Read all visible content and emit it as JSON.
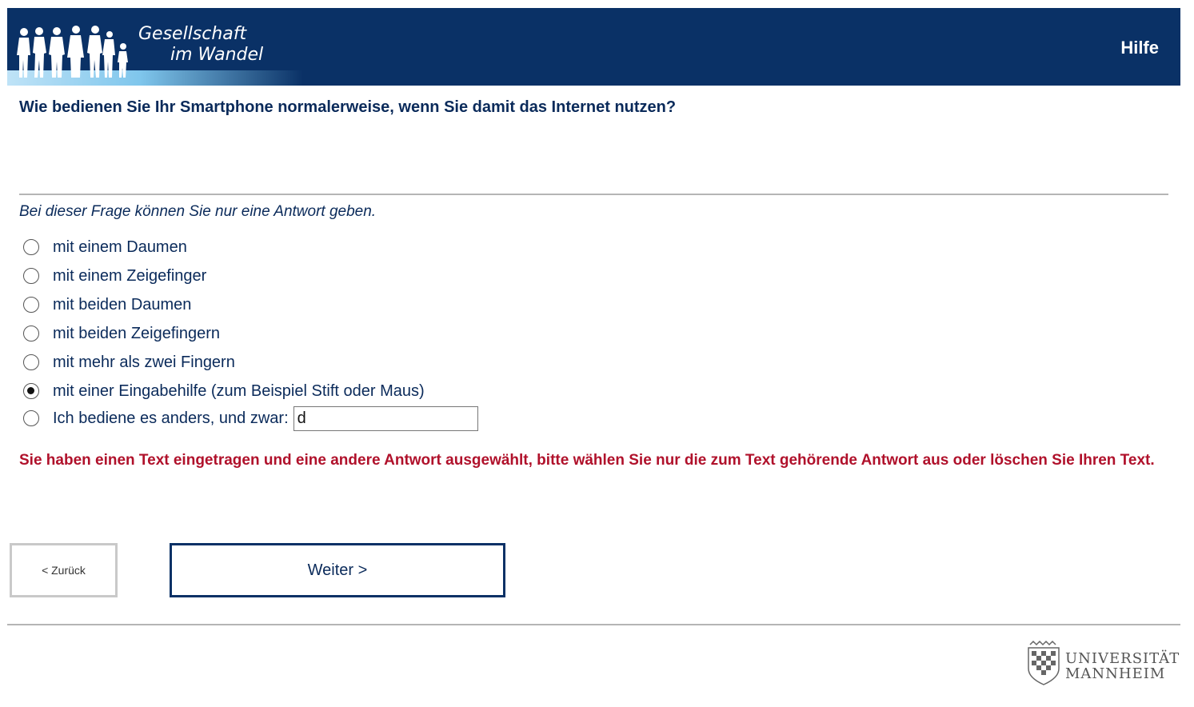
{
  "header": {
    "logo_line1": "Gesellschaft",
    "logo_line2": "im Wandel",
    "help_label": "Hilfe"
  },
  "question": {
    "text": "Wie bedienen Sie Ihr Smartphone normalerweise, wenn Sie damit das Internet nutzen?",
    "instruction": "Bei dieser Frage können Sie nur eine Antwort geben."
  },
  "options": [
    {
      "label": "mit einem Daumen",
      "selected": false
    },
    {
      "label": "mit einem Zeigefinger",
      "selected": false
    },
    {
      "label": "mit beiden Daumen",
      "selected": false
    },
    {
      "label": "mit beiden Zeigefingern",
      "selected": false
    },
    {
      "label": "mit mehr als zwei Fingern",
      "selected": false
    },
    {
      "label": "mit einer Eingabehilfe (zum Beispiel Stift oder Maus)",
      "selected": true
    },
    {
      "label": "Ich bediene es anders, und zwar:",
      "selected": false,
      "input_value": "d"
    }
  ],
  "error": "Sie haben einen Text eingetragen und eine andere Antwort ausgewählt, bitte wählen Sie nur die zum Text gehörende Antwort aus oder löschen Sie Ihren Text.",
  "nav": {
    "back_label": "< Zurück",
    "next_label": "Weiter >"
  },
  "footer": {
    "uni_line1": "UNIVERSITÄT",
    "uni_line2": "MANNHEIM"
  },
  "colors": {
    "header_bg": "#0a3166",
    "text": "#0a2a5a",
    "error": "#b0112b"
  }
}
